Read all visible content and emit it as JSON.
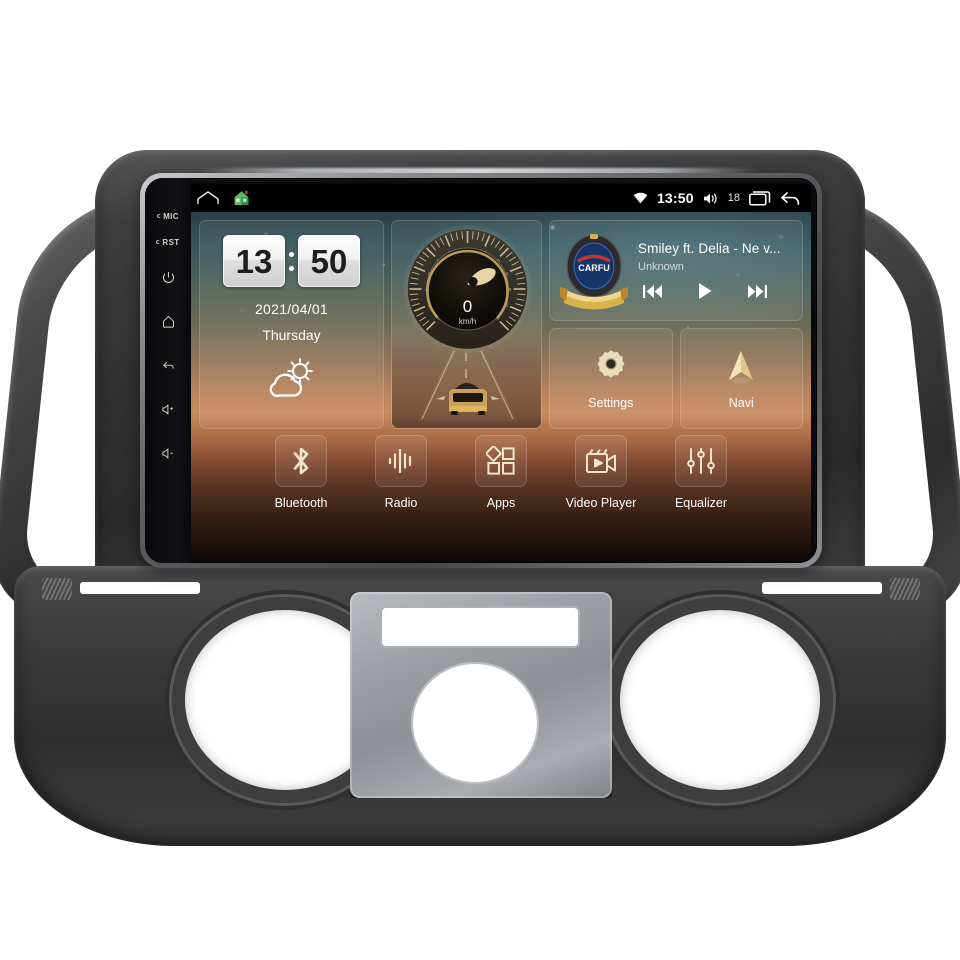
{
  "device": {
    "product_type": "car-stereo-head-unit",
    "bezel_keys": [
      {
        "name": "mic",
        "label": "MIC",
        "type": "text"
      },
      {
        "name": "reset",
        "label": "RST",
        "type": "text"
      },
      {
        "name": "power",
        "label": "",
        "icon": "power-icon"
      },
      {
        "name": "home",
        "label": "",
        "icon": "home-icon"
      },
      {
        "name": "back",
        "label": "",
        "icon": "back-arrow-icon"
      },
      {
        "name": "volume-up",
        "label": "",
        "icon": "volume-up-icon"
      },
      {
        "name": "volume-down",
        "label": "",
        "icon": "volume-down-icon"
      }
    ]
  },
  "statusbar": {
    "left_icons": [
      {
        "name": "recents-outline-icon",
        "label": "recents"
      },
      {
        "name": "home-green-icon",
        "label": "home"
      }
    ],
    "wifi_icon": "wifi-icon",
    "time": "13:50",
    "volume_icon": "volume-icon",
    "volume_level": "18",
    "recents_icon": "recent-apps-icon",
    "back_icon": "back-arrow-icon"
  },
  "clock_widget": {
    "hours": "13",
    "minutes": "50",
    "date": "2021/04/01",
    "weekday": "Thursday",
    "weather_icon": "sun-behind-cloud-icon"
  },
  "speedometer_widget": {
    "value": "0",
    "unit": "km/h",
    "ticks": [
      "0",
      "20",
      "40",
      "60",
      "80",
      "100",
      "120",
      "140",
      "160",
      "180",
      "200",
      "220",
      "240"
    ],
    "min": 0,
    "max": 240,
    "vehicle_icon": "car-on-road-icon"
  },
  "media_widget": {
    "album_art": "carfu-badge-logo",
    "brand_text": "CARFU",
    "title": "Smiley ft. Delia - Ne v...",
    "artist": "Unknown",
    "controls": [
      {
        "name": "previous-track-button",
        "icon": "skip-previous-icon"
      },
      {
        "name": "play-button",
        "icon": "play-icon"
      },
      {
        "name": "next-track-button",
        "icon": "skip-next-icon"
      }
    ]
  },
  "shortcuts": [
    {
      "name": "settings",
      "label": "Settings",
      "icon": "gear-icon"
    },
    {
      "name": "navi",
      "label": "Navi",
      "icon": "navigation-arrow-icon"
    }
  ],
  "dock": [
    {
      "name": "bluetooth",
      "label": "Bluetooth",
      "icon": "bluetooth-icon"
    },
    {
      "name": "radio",
      "label": "Radio",
      "icon": "radio-waveform-icon"
    },
    {
      "name": "apps",
      "label": "Apps",
      "icon": "apps-grid-icon"
    },
    {
      "name": "video-player",
      "label": "Video Player",
      "icon": "video-camera-icon"
    },
    {
      "name": "equalizer",
      "label": "Equalizer",
      "icon": "equalizer-sliders-icon"
    }
  ],
  "colors": {
    "accent_gold": "#e8d6a8",
    "screen_black": "#000000",
    "trim_gray": "#3a3a3a",
    "console_silver": "#9ea2a7",
    "wallpaper_top": "#2a4046",
    "wallpaper_mid": "#c98a5f",
    "wallpaper_bottom": "#120a07",
    "text_white": "#ffffff",
    "badge_blue": "#17356b",
    "badge_gold": "#d8b24a"
  }
}
